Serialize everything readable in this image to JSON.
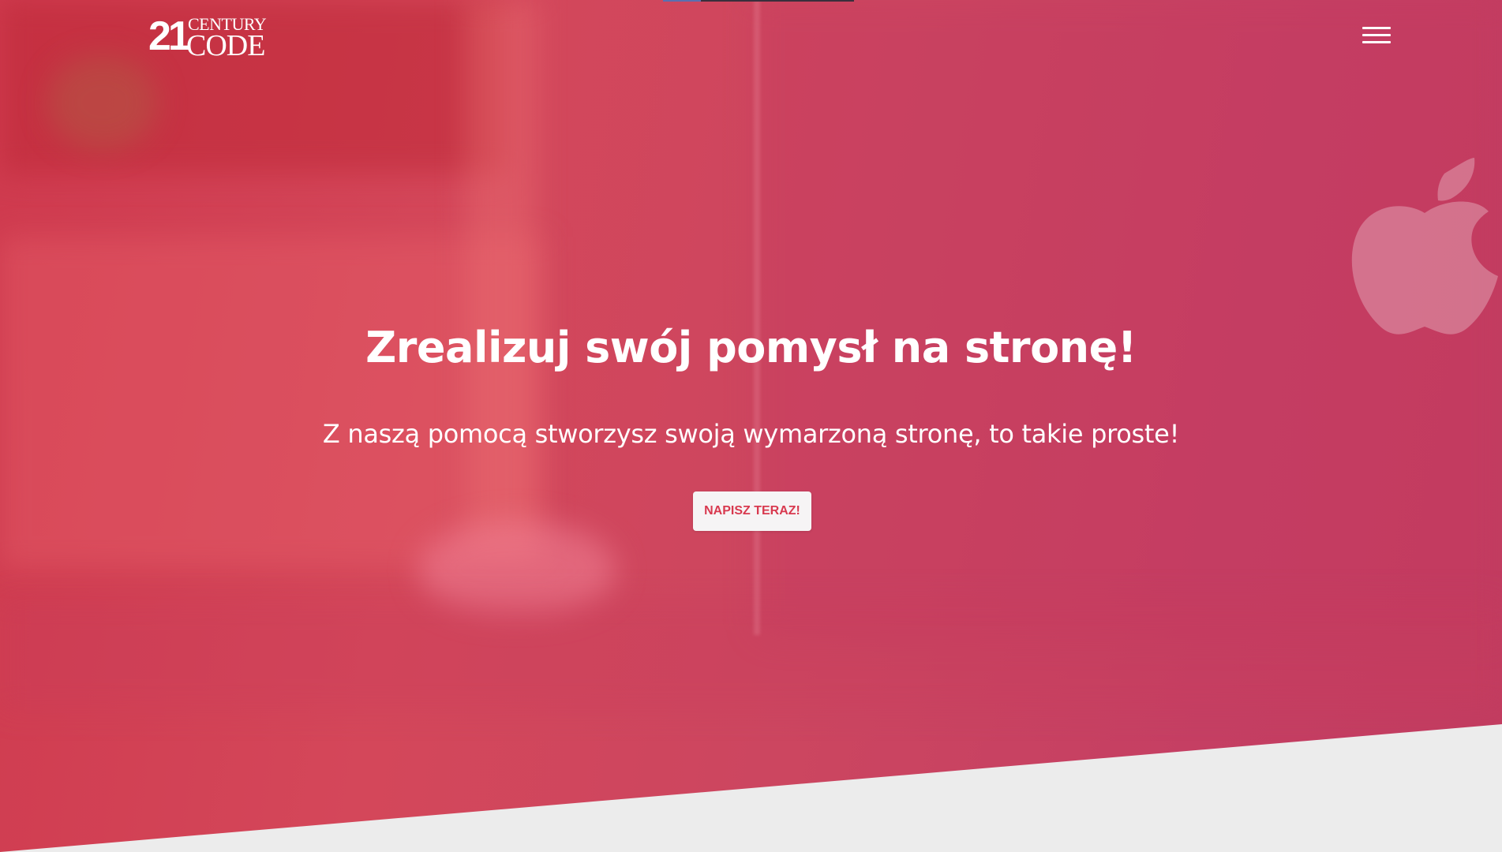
{
  "header": {
    "logo": {
      "number": "21",
      "word1": "CENTURY",
      "word2": "CODE"
    },
    "menu_icon": "hamburger-menu-icon"
  },
  "hero": {
    "title": "Zrealizuj swój pomysł na stronę!",
    "subtitle": "Z naszą pomocą stworzysz swoją wymarzoną stronę, to takie proste!",
    "cta_label": "NAPISZ TERAZ!"
  },
  "colors": {
    "hero_overlay": "#d4475a",
    "cta_text": "#d8394f",
    "cta_background": "#f6f4f5",
    "page_background": "#ececec",
    "text": "#ffffff"
  }
}
